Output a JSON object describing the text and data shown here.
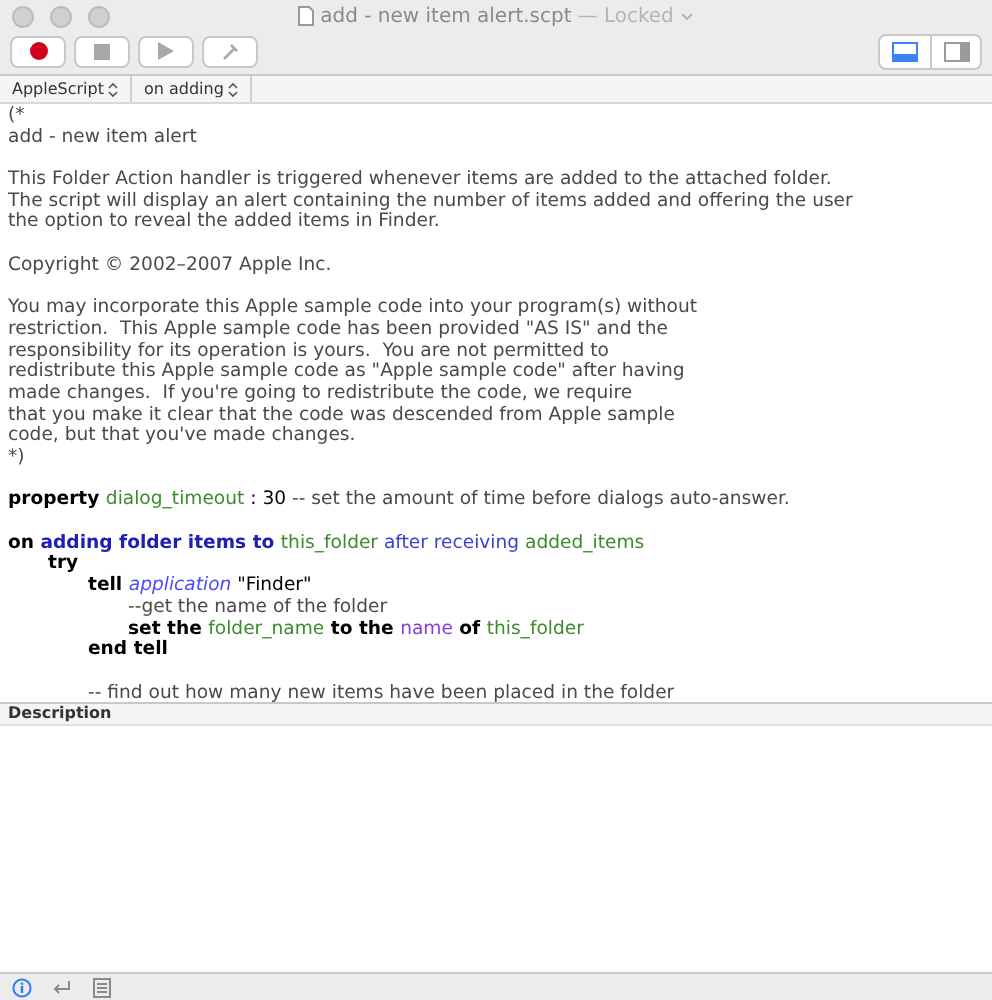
{
  "window": {
    "title": "add - new item alert.scpt",
    "status": "— Locked"
  },
  "toolbar": {
    "buttons": [
      {
        "kind": "record"
      },
      {
        "kind": "stop"
      },
      {
        "kind": "run"
      },
      {
        "kind": "compile"
      }
    ],
    "view_toggle": [
      {
        "kind": "bottom-pane",
        "selected": true
      },
      {
        "kind": "side-pane",
        "selected": false
      }
    ]
  },
  "navigation": {
    "language": "AppleScript",
    "handler": "on adding"
  },
  "editor": {
    "lines": [
      {
        "tokens": [
          {
            "kind": "comment",
            "text": "(*"
          }
        ]
      },
      {
        "tokens": [
          {
            "kind": "comment",
            "text": "add - new item alert"
          }
        ]
      },
      {
        "space_before": true,
        "tokens": [
          {
            "kind": "comment",
            "text": "This Folder Action handler is triggered whenever items are added to the attached folder."
          }
        ]
      },
      {
        "tokens": [
          {
            "kind": "comment",
            "text": "The script will display an alert containing the number of items added and offering the user"
          }
        ]
      },
      {
        "tokens": [
          {
            "kind": "comment",
            "text": "the option to reveal the added items in Finder."
          }
        ]
      },
      {
        "space_before": true,
        "tokens": [
          {
            "kind": "comment",
            "text": "Copyright © 2002–2007 Apple Inc."
          }
        ]
      },
      {
        "space_before": true,
        "tokens": [
          {
            "kind": "comment",
            "text": "You may incorporate this Apple sample code into your program(s) without"
          }
        ]
      },
      {
        "tokens": [
          {
            "kind": "comment",
            "text": "restriction.  This Apple sample code has been provided \"AS IS\" and the"
          }
        ]
      },
      {
        "tokens": [
          {
            "kind": "comment",
            "text": "responsibility for its operation is yours.  You are not permitted to"
          }
        ]
      },
      {
        "tokens": [
          {
            "kind": "comment",
            "text": "redistribute this Apple sample code as \"Apple sample code\" after having"
          }
        ]
      },
      {
        "tokens": [
          {
            "kind": "comment",
            "text": "made changes.  If you're going to redistribute the code, we require"
          }
        ]
      },
      {
        "tokens": [
          {
            "kind": "comment",
            "text": "that you make it clear that the code was descended from Apple sample"
          }
        ]
      },
      {
        "tokens": [
          {
            "kind": "comment",
            "text": "code, but that you've made changes."
          }
        ]
      },
      {
        "tokens": [
          {
            "kind": "comment",
            "text": "*)"
          }
        ]
      },
      {
        "space_before": true,
        "tokens": [
          {
            "kind": "keyword",
            "text": "property "
          },
          {
            "kind": "variable",
            "text": "dialog_timeout"
          },
          {
            "kind": "plain",
            "text": " : 30 "
          },
          {
            "kind": "comment",
            "text": "-- set the amount of time before dialogs auto-answer."
          }
        ]
      },
      {
        "space_before": true,
        "tokens": [
          {
            "kind": "keyword",
            "text": "on "
          },
          {
            "kind": "handler",
            "text": "adding folder items to "
          },
          {
            "kind": "variable",
            "text": "this_folder"
          },
          {
            "kind": "label",
            "text": " after receiving "
          },
          {
            "kind": "variable",
            "text": "added_items"
          }
        ],
        "children": [
          {
            "tokens": [
              {
                "kind": "keyword",
                "text": "try"
              }
            ],
            "children": [
              {
                "tokens": [
                  {
                    "kind": "keyword",
                    "text": "tell "
                  },
                  {
                    "kind": "class",
                    "text": "application"
                  },
                  {
                    "kind": "plain",
                    "text": " \"Finder\""
                  }
                ],
                "children": [
                  {
                    "tokens": [
                      {
                        "kind": "comment",
                        "text": "--get the name of the folder"
                      }
                    ]
                  },
                  {
                    "tokens": [
                      {
                        "kind": "keyword",
                        "text": "set the "
                      },
                      {
                        "kind": "variable",
                        "text": "folder_name"
                      },
                      {
                        "kind": "keyword",
                        "text": " to the "
                      },
                      {
                        "kind": "property",
                        "text": "name"
                      },
                      {
                        "kind": "keyword",
                        "text": " of "
                      },
                      {
                        "kind": "variable",
                        "text": "this_folder"
                      }
                    ]
                  }
                ]
              },
              {
                "tokens": [
                  {
                    "kind": "keyword",
                    "text": "end tell"
                  }
                ]
              },
              {
                "space_before": true,
                "tokens": [
                  {
                    "kind": "comment",
                    "text": "-- find out how many new items have been placed in the folder"
                  }
                ]
              }
            ]
          }
        ]
      }
    ]
  },
  "description_pane": {
    "title": "Description"
  },
  "bottom_bar": {
    "buttons": [
      {
        "kind": "info",
        "selected": true
      },
      {
        "kind": "result",
        "selected": false
      },
      {
        "kind": "log",
        "selected": false
      }
    ]
  }
}
